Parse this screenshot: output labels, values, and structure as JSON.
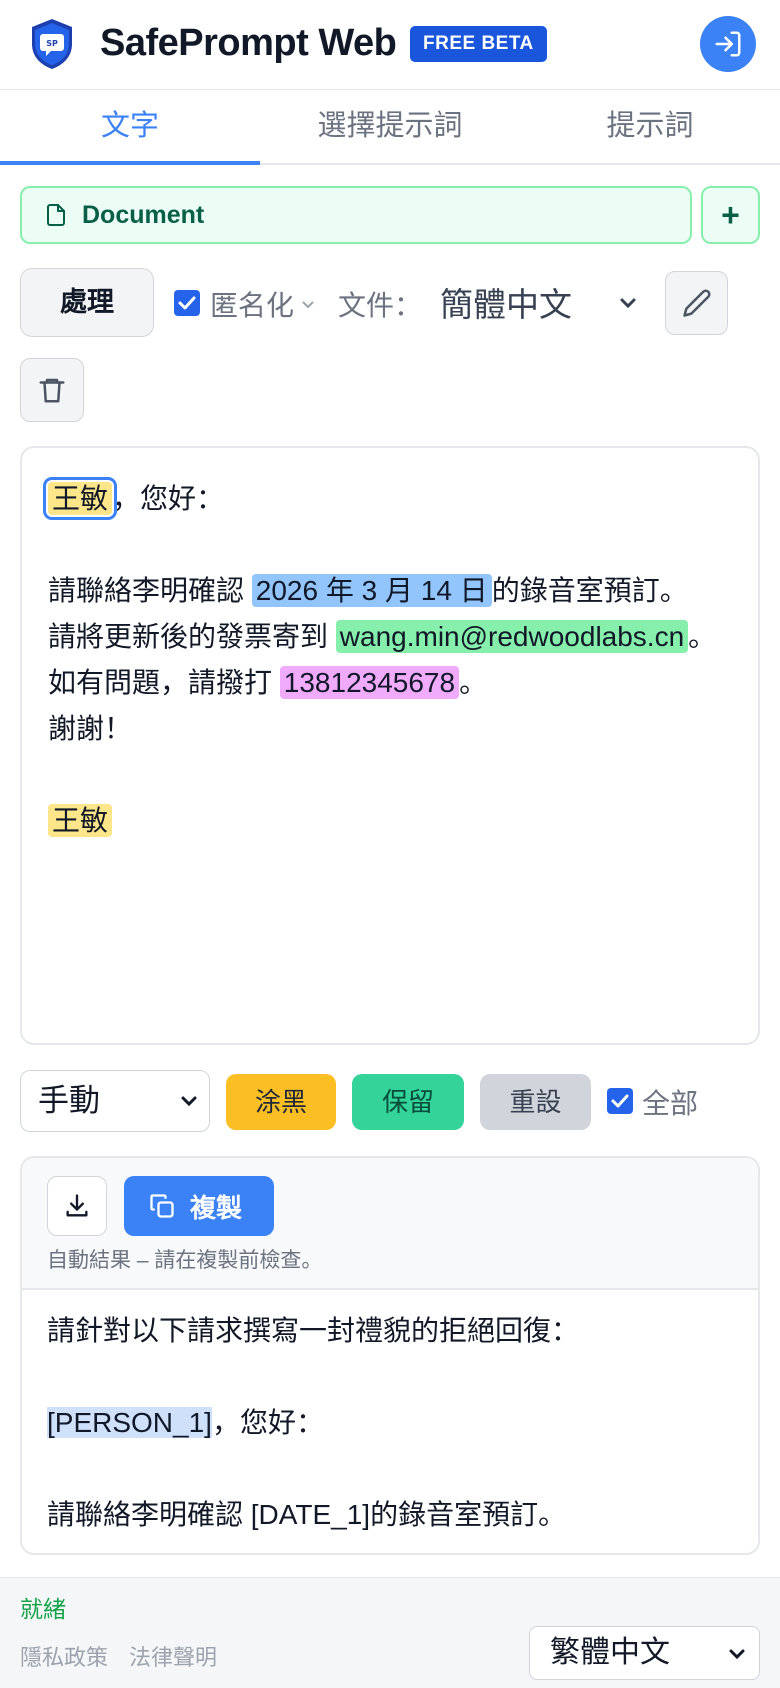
{
  "header": {
    "logo_text": "SP",
    "title": "SafePrompt Web",
    "badge": "FREE BETA",
    "login_icon": "login-icon"
  },
  "tabs": [
    {
      "label": "文字",
      "active": true
    },
    {
      "label": "選擇提示詞",
      "active": false
    },
    {
      "label": "提示詞",
      "active": false
    }
  ],
  "document": {
    "label": "Document",
    "icon": "file-icon",
    "add_label": "+"
  },
  "controls": {
    "process_label": "處理",
    "anonymize_label": "匿名化",
    "anonymize_checked": true,
    "file_label": "文件：",
    "file_language": "簡體中文",
    "edit_icon": "pencil-icon",
    "delete_icon": "trash-icon"
  },
  "editor": {
    "l1_name": "王敏",
    "l1_rest": "，您好：",
    "l2_pre": "請聯絡李明確認 ",
    "l2_date": "2026 年 3 月 14 日",
    "l2_post": "的錄音室預訂。",
    "l3_pre": "請將更新後的發票寄到 ",
    "l3_email": "wang.min@redwoodlabs.cn",
    "l3_post": "。",
    "l4_pre": "如有問題，請撥打 ",
    "l4_phone": "13812345678",
    "l4_post": "。",
    "l5": "謝謝！",
    "l6_name": "王敏"
  },
  "actions": {
    "mode": "手動",
    "black_label": "涂黑",
    "keep_label": "保留",
    "reset_label": "重設",
    "all_label": "全部",
    "all_checked": true
  },
  "output": {
    "copy_label": "複製",
    "note": "自動結果 – 請在複製前檢查。",
    "l1": "請針對以下請求撰寫一封禮貌的拒絕回復：",
    "l2_token": "[PERSON_1]",
    "l2_rest": "，您好：",
    "l3": "請聯絡李明確認 [DATE_1]的錄音室預訂。"
  },
  "footer": {
    "status": "就緒",
    "privacy": "隱私政策",
    "legal": "法律聲明",
    "language": "繁體中文"
  },
  "colors": {
    "accent": "#3b82f6",
    "badge": "#1a56db",
    "person": "#fde68a",
    "date": "#93c5fd",
    "email": "#86efac",
    "phone": "#f0abfc",
    "status": "#16a34a"
  }
}
